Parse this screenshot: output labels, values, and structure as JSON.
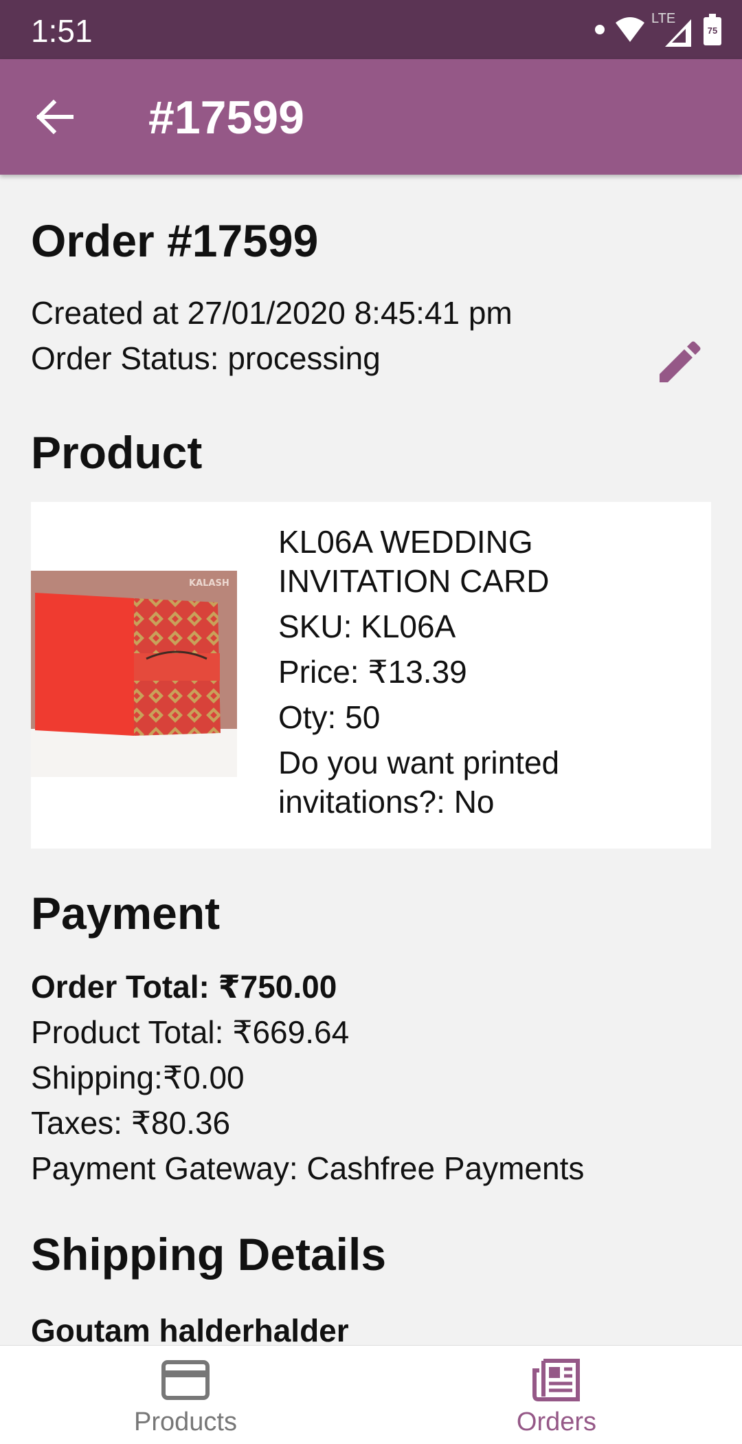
{
  "status_bar": {
    "time": "1:51",
    "network": "LTE",
    "battery": "75"
  },
  "app_bar": {
    "title": "#17599",
    "back_icon": "arrow-left-icon"
  },
  "order": {
    "heading": "Order #17599",
    "created": "Created at 27/01/2020 8:45:41 pm",
    "status": "Order Status: processing",
    "edit_icon": "pencil-icon"
  },
  "product_section": {
    "heading": "Product",
    "item": {
      "name": "KL06A WEDDING INVITATION CARD",
      "sku": "SKU: KL06A",
      "price": "Price: ₹13.39",
      "qty": "Oty: 50",
      "option": "Do you want printed invitations?: No",
      "image_brand": "KALASH"
    }
  },
  "payment": {
    "heading": "Payment",
    "order_total": "Order Total: ₹750.00",
    "product_total": "Product Total: ₹669.64",
    "shipping": "Shipping:₹0.00",
    "taxes": "Taxes: ₹80.36",
    "gateway": "Payment Gateway: Cashfree Payments"
  },
  "shipping_details": {
    "heading": "Shipping Details",
    "name": "Goutam halderhalder"
  },
  "bottom_nav": {
    "products": {
      "label": "Products",
      "icon": "credit-card-icon"
    },
    "orders": {
      "label": "Orders",
      "icon": "newspaper-icon"
    }
  },
  "colors": {
    "status_bar": "#5b3454",
    "app_bar": "#955887",
    "accent": "#955887"
  }
}
